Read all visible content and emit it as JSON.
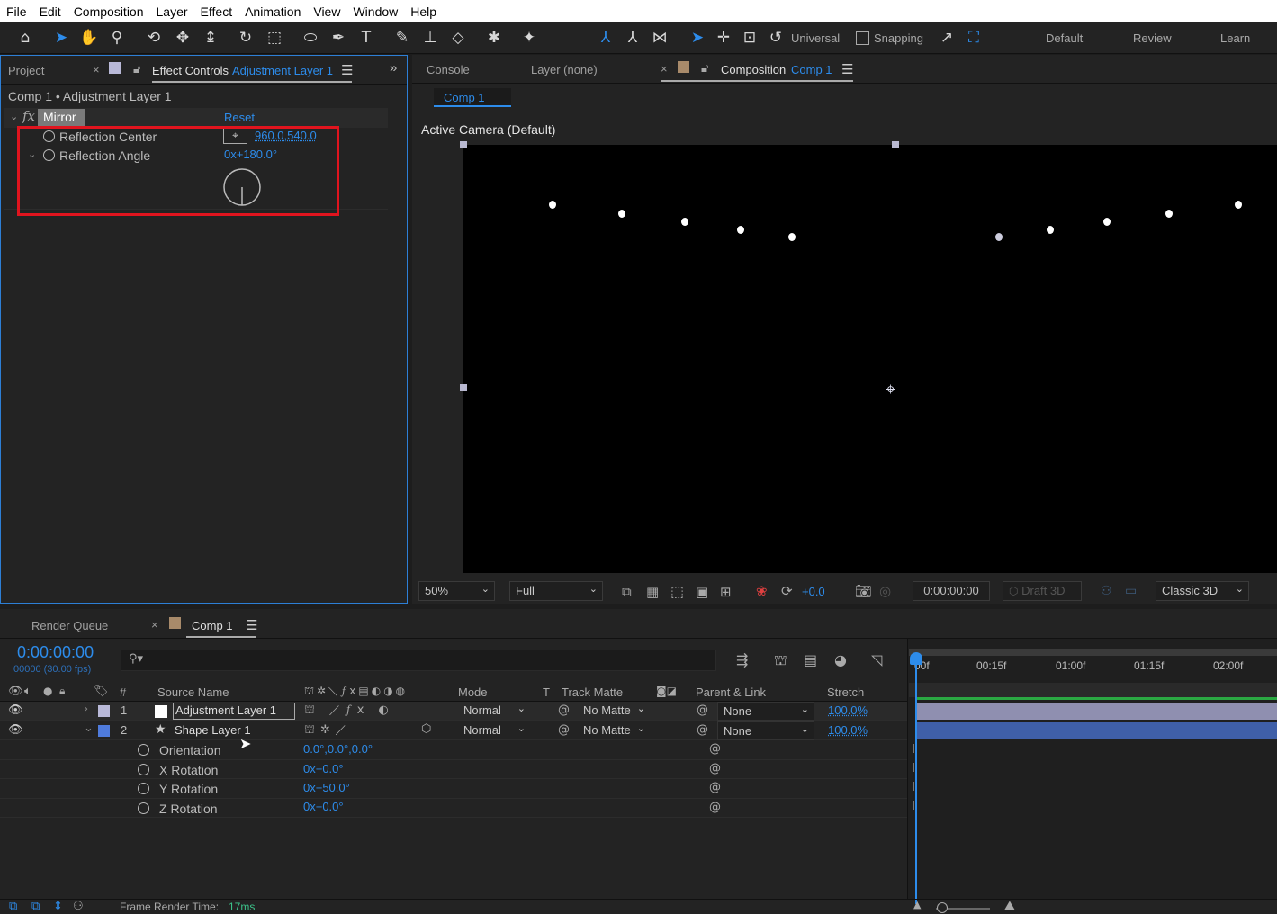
{
  "menu": [
    "File",
    "Edit",
    "Composition",
    "Layer",
    "Effect",
    "Animation",
    "View",
    "Window",
    "Help"
  ],
  "toolbar": {
    "universal": "Universal",
    "snapping": "Snapping",
    "workspaces": [
      "Default",
      "Review",
      "Learn"
    ]
  },
  "left_panel": {
    "project_tab": "Project",
    "effect_controls_tab": "Effect Controls",
    "effect_controls_layer": "Adjustment Layer 1",
    "breadcrumb": "Comp 1 • Adjustment Layer 1",
    "fx_label": "fx",
    "effect_name": "Mirror",
    "reset": "Reset",
    "reflection_center_label": "Reflection Center",
    "reflection_center_value": "960.0,540.0",
    "reflection_angle_label": "Reflection Angle",
    "reflection_angle_value": "0x+180.0°"
  },
  "right_panel": {
    "console_tab": "Console",
    "layer_tab": "Layer (none)",
    "composition_tab": "Composition",
    "composition_name": "Comp 1",
    "comp_subtab": "Comp 1",
    "camera_label": "Active Camera (Default)"
  },
  "viewer_bar": {
    "zoom": "50%",
    "resolution": "Full",
    "exposure": "+0.0",
    "timecode": "0:00:00:00",
    "draft3d": "Draft 3D",
    "renderer": "Classic 3D"
  },
  "timeline": {
    "render_queue_tab": "Render Queue",
    "comp_tab": "Comp 1",
    "timecode": "0:00:00:00",
    "frames": "00000 (30.00 fps)",
    "search_placeholder": "",
    "col_hash": "#",
    "col_source": "Source Name",
    "col_mode": "Mode",
    "col_t": "T",
    "col_track_matte": "Track Matte",
    "col_parent": "Parent & Link",
    "col_stretch": "Stretch",
    "ruler": [
      "00f",
      "00:15f",
      "01:00f",
      "01:15f",
      "02:00f"
    ],
    "layers": [
      {
        "num": "1",
        "name": "Adjustment Layer 1",
        "mode": "Normal",
        "matte": "No Matte",
        "parent": "None",
        "stretch": "100.0%",
        "color": "#b9b9d8"
      },
      {
        "num": "2",
        "name": "Shape Layer 1",
        "mode": "Normal",
        "matte": "No Matte",
        "parent": "None",
        "stretch": "100.0%",
        "color": "#4f7bdc"
      }
    ],
    "props": [
      {
        "label": "Orientation",
        "value": "0.0°,0.0°,0.0°"
      },
      {
        "label": "X Rotation",
        "value": "0x+0.0°"
      },
      {
        "label": "Y Rotation",
        "value": "0x+50.0°"
      },
      {
        "label": "Z Rotation",
        "value": "0x+0.0°"
      }
    ],
    "frame_render_label": "Frame Render Time:",
    "frame_render_value": "17ms"
  }
}
